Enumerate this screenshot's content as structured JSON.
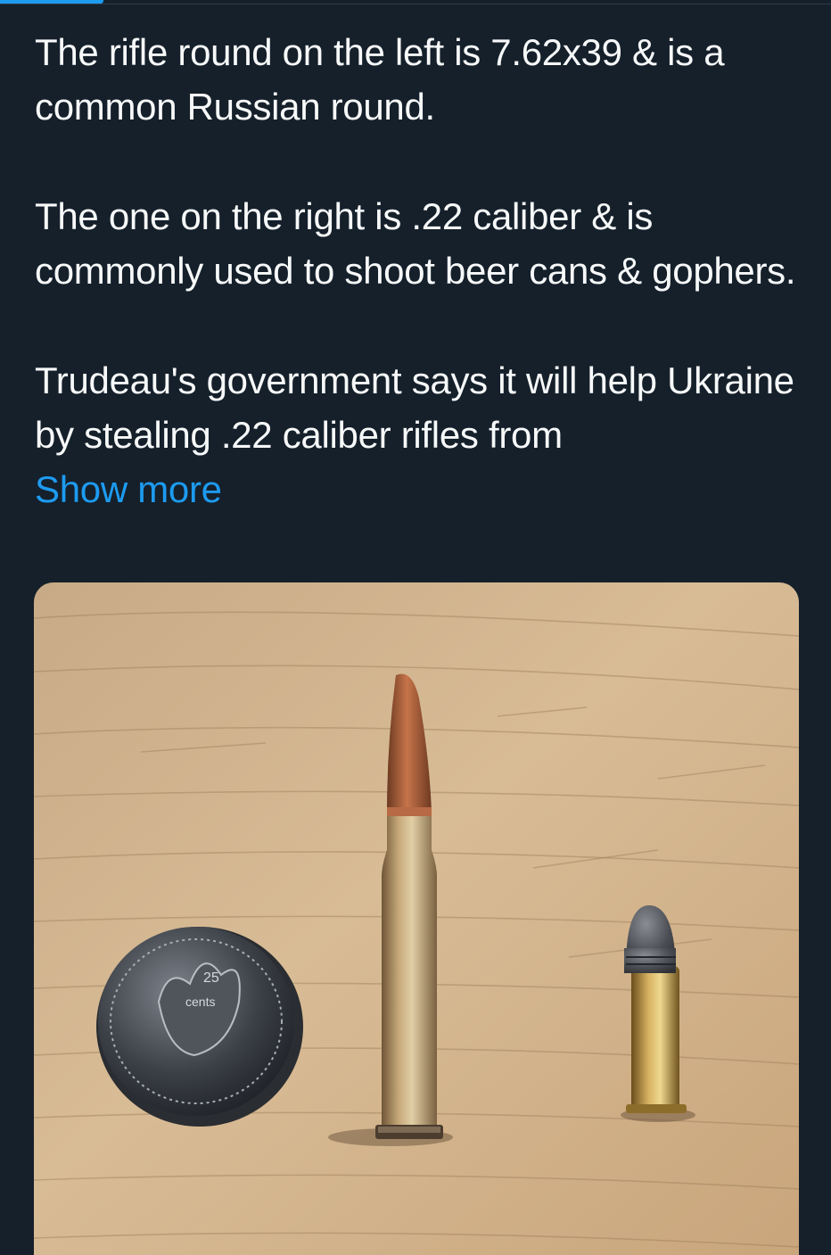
{
  "header": {
    "active_tab": "tab"
  },
  "tweet": {
    "paragraph_1": "The rifle round on the left is 7.62x39 & is a common Russian round.",
    "paragraph_2": "The one on the right is .22 caliber & is commonly used to shoot beer cans & gophers.",
    "paragraph_3": "Trudeau's government says it will help Ukraine by stealing .22 caliber rifles from",
    "show_more": "Show more"
  },
  "photo": {
    "subject": "7.62x39 round, .22 caliber round and a Canadian quarter on a wooden table",
    "coin_text": "cents",
    "coin_value": "25"
  },
  "colors": {
    "background": "#15202b",
    "text": "#f7f9f9",
    "link": "#1d9bf0"
  }
}
